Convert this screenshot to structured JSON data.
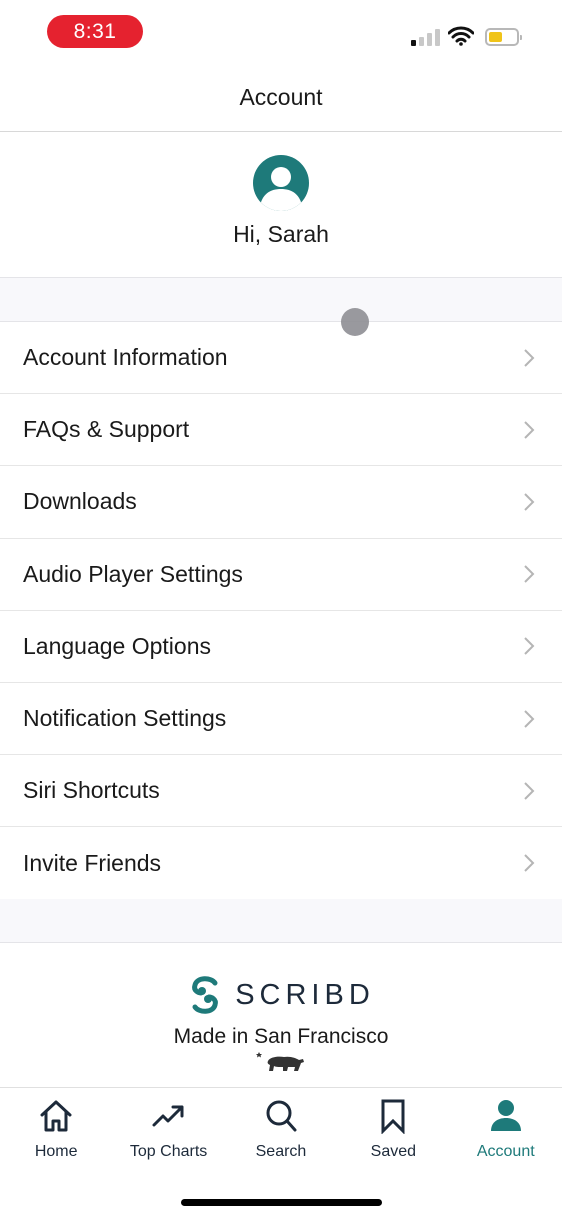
{
  "status_bar": {
    "time": "8:31",
    "signal_bars_active": 1,
    "signal_bars_total": 4,
    "battery_level": 0.5,
    "battery_color": "#f0c419",
    "time_pill_color": "#e5222f"
  },
  "header": {
    "title": "Account"
  },
  "profile": {
    "greeting": "Hi, Sarah",
    "avatar_icon": "user-avatar-icon"
  },
  "menu": {
    "items": [
      {
        "label": "Account Information"
      },
      {
        "label": "FAQs & Support"
      },
      {
        "label": "Downloads"
      },
      {
        "label": "Audio Player Settings"
      },
      {
        "label": "Language Options"
      },
      {
        "label": "Notification Settings"
      },
      {
        "label": "Siri Shortcuts"
      },
      {
        "label": "Invite Friends"
      }
    ]
  },
  "footer": {
    "brand_name": "SCRIBD",
    "tagline": "Made in San Francisco",
    "emblem": "california-bear-icon"
  },
  "tab_bar": {
    "accent_color": "#1e7a7a",
    "tabs": [
      {
        "label": "Home",
        "icon": "home-icon",
        "active": false
      },
      {
        "label": "Top Charts",
        "icon": "trending-icon",
        "active": false
      },
      {
        "label": "Search",
        "icon": "search-icon",
        "active": false
      },
      {
        "label": "Saved",
        "icon": "bookmark-icon",
        "active": false
      },
      {
        "label": "Account",
        "icon": "account-icon",
        "active": true
      }
    ]
  }
}
